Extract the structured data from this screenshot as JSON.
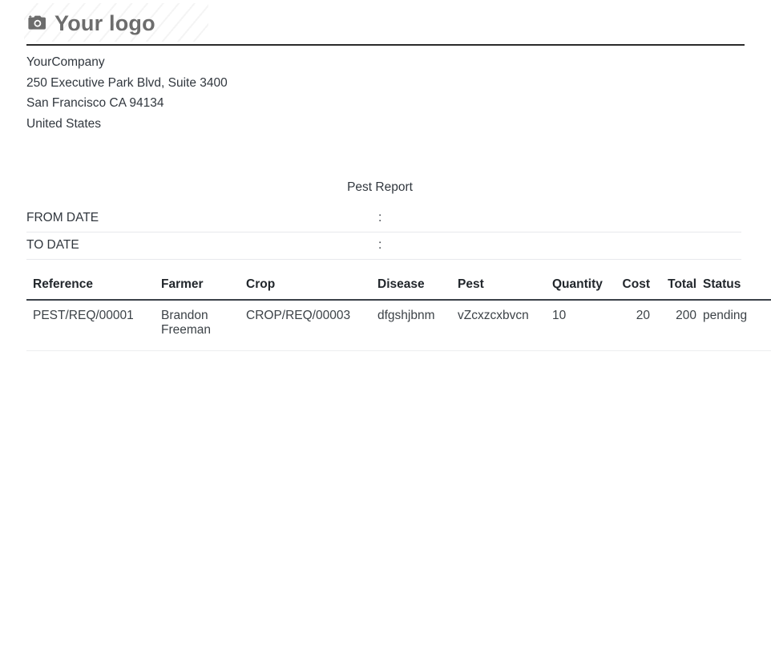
{
  "header": {
    "logo_icon": "camera-icon",
    "logo_text": "Your logo"
  },
  "company": {
    "name": "YourCompany",
    "street": "250 Executive Park Blvd, Suite 3400",
    "city_state_zip": "San Francisco CA 94134",
    "country": "United States"
  },
  "report": {
    "title": "Pest Report",
    "filters": [
      {
        "label": "FROM DATE",
        "separator": ":",
        "value": ""
      },
      {
        "label": "TO DATE",
        "separator": ":",
        "value": ""
      }
    ]
  },
  "table": {
    "columns": [
      "Reference",
      "Farmer",
      "Crop",
      "Disease",
      "Pest",
      "Quantity",
      "Cost",
      "Total",
      "Status"
    ],
    "rows": [
      {
        "reference": "PEST/REQ/00001",
        "farmer": "Brandon Freeman",
        "crop": "CROP/REQ/00003",
        "disease": "dfgshjbnm",
        "pest": "vZcxzcxbvcn",
        "quantity": "10",
        "cost": "20",
        "total": "200",
        "status": "pending"
      }
    ]
  },
  "colors": {
    "text": "#31373e",
    "logo_gray": "#6d6d6d",
    "header_rule": "#2b2b2b",
    "table_rule": "#3b4148",
    "row_rule": "#eceef0"
  }
}
